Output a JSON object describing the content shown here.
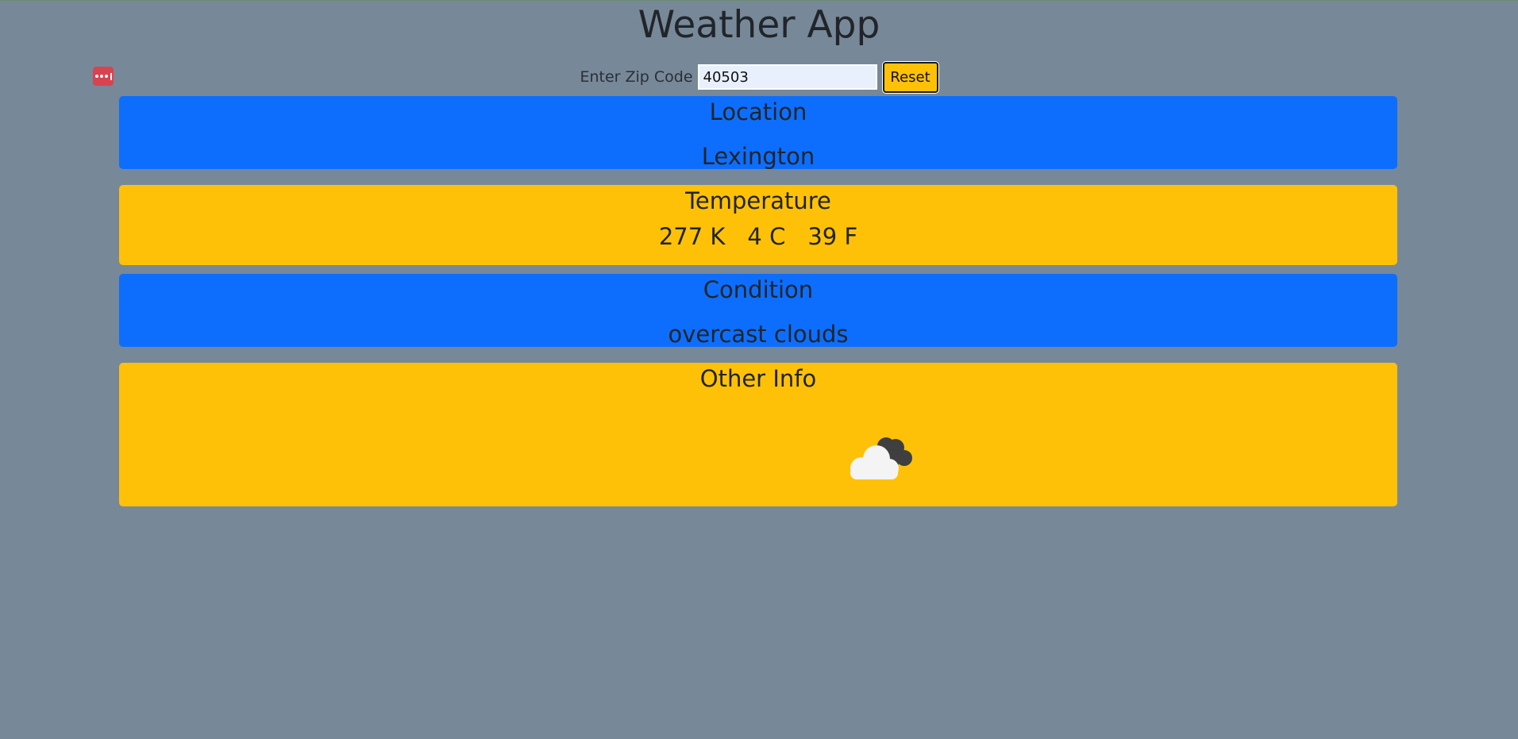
{
  "app": {
    "title": "Weather App"
  },
  "search": {
    "label": "Enter Zip Code",
    "value": "40503",
    "reset_label": "Reset"
  },
  "location": {
    "title": "Location",
    "value": "Lexington"
  },
  "temperature": {
    "title": "Temperature",
    "kelvin": "277 K",
    "celsius": "4 C",
    "fahrenheit": "39 F"
  },
  "condition": {
    "title": "Condition",
    "value": "overcast clouds"
  },
  "other_info": {
    "title": "Other Info",
    "icon": "overcast-clouds-icon"
  },
  "colors": {
    "background": "#778899",
    "card_blue": "#0d6efd",
    "card_yellow": "#ffc107",
    "extension_icon": "#d9434f"
  }
}
